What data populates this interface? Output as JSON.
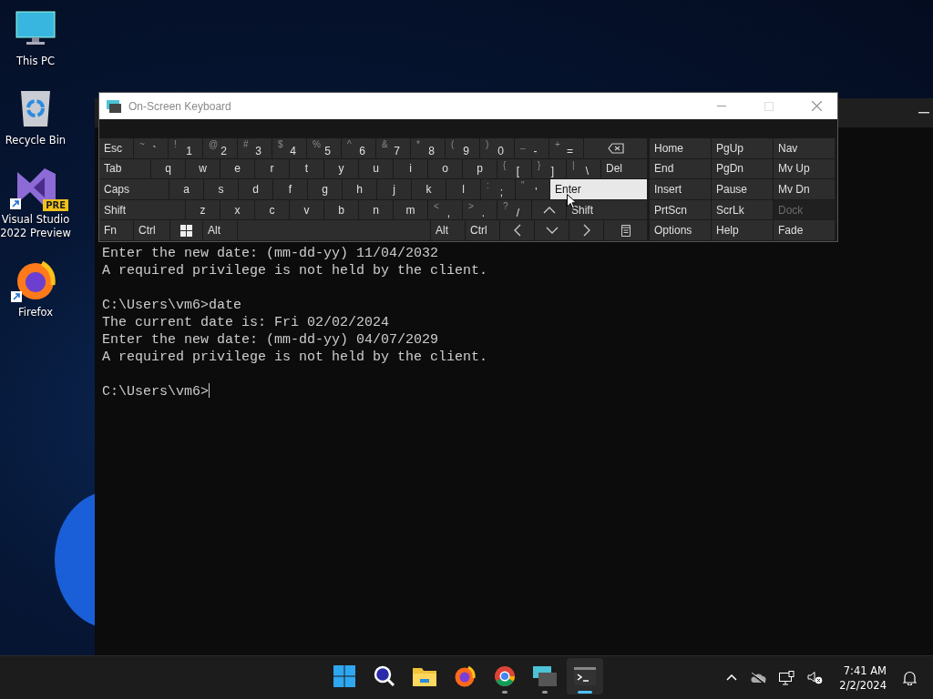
{
  "desktop_icons": [
    {
      "label": "This PC",
      "kind": "pc",
      "shortcut": false
    },
    {
      "label": "Recycle Bin",
      "kind": "bin",
      "shortcut": false
    },
    {
      "label": "Visual Studio 2022 Preview",
      "kind": "vs",
      "shortcut": true,
      "badge": "PRE"
    },
    {
      "label": "Firefox",
      "kind": "firefox",
      "shortcut": true
    }
  ],
  "terminal": {
    "blocks": [
      [
        "Enter the new date: (mm-dd-yy) 11/04/2032",
        "A required privilege is not held by the client."
      ],
      [
        "C:\\Users\\vm6>date",
        "The current date is: Fri 02/02/2024",
        "Enter the new date: (mm-dd-yy) 04/07/2029",
        "A required privilege is not held by the client."
      ]
    ],
    "prompt": "C:\\Users\\vm6>"
  },
  "osk": {
    "title": "On-Screen Keyboard",
    "rows": [
      {
        "keys": [
          {
            "kind": "text",
            "label": "Esc",
            "hover": false,
            "disabled": false
          },
          {
            "kind": "dual",
            "shift": "~",
            "label": "`",
            "hover": false,
            "disabled": false
          },
          {
            "kind": "dual",
            "shift": "!",
            "label": "1",
            "hover": false,
            "disabled": false
          },
          {
            "kind": "dual",
            "shift": "@",
            "label": "2",
            "hover": false,
            "disabled": false
          },
          {
            "kind": "dual",
            "shift": "#",
            "label": "3",
            "hover": false,
            "disabled": false
          },
          {
            "kind": "dual",
            "shift": "$",
            "label": "4",
            "hover": false,
            "disabled": false
          },
          {
            "kind": "dual",
            "shift": "%",
            "label": "5",
            "hover": false,
            "disabled": false
          },
          {
            "kind": "dual",
            "shift": "^",
            "label": "6",
            "hover": false,
            "disabled": false
          },
          {
            "kind": "dual",
            "shift": "&",
            "label": "7",
            "hover": false,
            "disabled": false
          },
          {
            "kind": "dual",
            "shift": "*",
            "label": "8",
            "hover": false,
            "disabled": false
          },
          {
            "kind": "dual",
            "shift": "(",
            "label": "9",
            "hover": false,
            "disabled": false
          },
          {
            "kind": "dual",
            "shift": ")",
            "label": "0",
            "hover": false,
            "disabled": false
          },
          {
            "kind": "dual",
            "shift": "_",
            "label": "-",
            "hover": false,
            "disabled": false
          },
          {
            "kind": "dual",
            "shift": "+",
            "label": "=",
            "hover": false,
            "disabled": false
          },
          {
            "kind": "backspace",
            "hover": false,
            "disabled": false
          }
        ]
      },
      {
        "keys": [
          {
            "kind": "text",
            "label": "Tab",
            "hover": false,
            "disabled": false
          },
          {
            "kind": "letter",
            "label": "q",
            "hover": false,
            "disabled": false
          },
          {
            "kind": "letter",
            "label": "w",
            "hover": false,
            "disabled": false
          },
          {
            "kind": "letter",
            "label": "e",
            "hover": false,
            "disabled": false
          },
          {
            "kind": "letter",
            "label": "r",
            "hover": false,
            "disabled": false
          },
          {
            "kind": "letter",
            "label": "t",
            "hover": false,
            "disabled": false
          },
          {
            "kind": "letter",
            "label": "y",
            "hover": false,
            "disabled": false
          },
          {
            "kind": "letter",
            "label": "u",
            "hover": false,
            "disabled": false
          },
          {
            "kind": "letter",
            "label": "i",
            "hover": false,
            "disabled": false
          },
          {
            "kind": "letter",
            "label": "o",
            "hover": false,
            "disabled": false
          },
          {
            "kind": "letter",
            "label": "p",
            "hover": false,
            "disabled": false
          },
          {
            "kind": "dual",
            "shift": "{",
            "label": "[",
            "hover": false,
            "disabled": false
          },
          {
            "kind": "dual",
            "shift": "}",
            "label": "]",
            "hover": false,
            "disabled": false
          },
          {
            "kind": "dual",
            "shift": "|",
            "label": "\\",
            "hover": false,
            "disabled": false
          },
          {
            "kind": "text",
            "label": "Del",
            "hover": false,
            "disabled": false
          }
        ]
      },
      {
        "keys": [
          {
            "kind": "text",
            "label": "Caps",
            "hover": false,
            "disabled": false
          },
          {
            "kind": "letter",
            "label": "a",
            "hover": false,
            "disabled": false
          },
          {
            "kind": "letter",
            "label": "s",
            "hover": false,
            "disabled": false
          },
          {
            "kind": "letter",
            "label": "d",
            "hover": false,
            "disabled": false
          },
          {
            "kind": "letter",
            "label": "f",
            "hover": false,
            "disabled": false
          },
          {
            "kind": "letter",
            "label": "g",
            "hover": false,
            "disabled": false
          },
          {
            "kind": "letter",
            "label": "h",
            "hover": false,
            "disabled": false
          },
          {
            "kind": "letter",
            "label": "j",
            "hover": false,
            "disabled": false
          },
          {
            "kind": "letter",
            "label": "k",
            "hover": false,
            "disabled": false
          },
          {
            "kind": "letter",
            "label": "l",
            "hover": false,
            "disabled": false
          },
          {
            "kind": "dual",
            "shift": ":",
            "label": ";",
            "hover": false,
            "disabled": false
          },
          {
            "kind": "dual",
            "shift": "\"",
            "label": "'",
            "hover": false,
            "disabled": false
          },
          {
            "kind": "text",
            "label": "Enter",
            "hover": true,
            "disabled": false
          }
        ]
      },
      {
        "keys": [
          {
            "kind": "text",
            "label": "Shift",
            "hover": false,
            "disabled": false
          },
          {
            "kind": "letter",
            "label": "z",
            "hover": false,
            "disabled": false
          },
          {
            "kind": "letter",
            "label": "x",
            "hover": false,
            "disabled": false
          },
          {
            "kind": "letter",
            "label": "c",
            "hover": false,
            "disabled": false
          },
          {
            "kind": "letter",
            "label": "v",
            "hover": false,
            "disabled": false
          },
          {
            "kind": "letter",
            "label": "b",
            "hover": false,
            "disabled": false
          },
          {
            "kind": "letter",
            "label": "n",
            "hover": false,
            "disabled": false
          },
          {
            "kind": "letter",
            "label": "m",
            "hover": false,
            "disabled": false
          },
          {
            "kind": "dual",
            "shift": "<",
            "label": ",",
            "hover": false,
            "disabled": false
          },
          {
            "kind": "dual",
            "shift": ">",
            "label": ".",
            "hover": false,
            "disabled": false
          },
          {
            "kind": "dual",
            "shift": "?",
            "label": "/",
            "hover": false,
            "disabled": false
          },
          {
            "kind": "up",
            "hover": false,
            "disabled": false
          },
          {
            "kind": "text",
            "label": "Shift",
            "hover": false,
            "disabled": false
          }
        ]
      },
      {
        "keys": [
          {
            "kind": "text",
            "label": "Fn",
            "hover": false,
            "disabled": false
          },
          {
            "kind": "text",
            "label": "Ctrl",
            "hover": false,
            "disabled": false
          },
          {
            "kind": "windows",
            "hover": false,
            "disabled": false
          },
          {
            "kind": "text",
            "label": "Alt",
            "hover": false,
            "disabled": false
          },
          {
            "kind": "space",
            "hover": false,
            "disabled": false
          },
          {
            "kind": "text",
            "label": "Alt",
            "hover": false,
            "disabled": false
          },
          {
            "kind": "text",
            "label": "Ctrl",
            "hover": false,
            "disabled": false
          },
          {
            "kind": "left",
            "hover": false,
            "disabled": false
          },
          {
            "kind": "down",
            "hover": false,
            "disabled": false
          },
          {
            "kind": "right",
            "hover": false,
            "disabled": false
          },
          {
            "kind": "menu",
            "hover": false,
            "disabled": false
          }
        ]
      }
    ],
    "side_rows": [
      {
        "keys": [
          {
            "kind": "text",
            "label": "Home",
            "hover": false,
            "disabled": false
          },
          {
            "kind": "text",
            "label": "PgUp",
            "hover": false,
            "disabled": false
          },
          {
            "kind": "text",
            "label": "Nav",
            "hover": false,
            "disabled": false
          }
        ]
      },
      {
        "keys": [
          {
            "kind": "text",
            "label": "End",
            "hover": false,
            "disabled": false
          },
          {
            "kind": "text",
            "label": "PgDn",
            "hover": false,
            "disabled": false
          },
          {
            "kind": "text",
            "label": "Mv Up",
            "hover": false,
            "disabled": false
          }
        ]
      },
      {
        "keys": [
          {
            "kind": "text",
            "label": "Insert",
            "hover": false,
            "disabled": false
          },
          {
            "kind": "text",
            "label": "Pause",
            "hover": false,
            "disabled": false
          },
          {
            "kind": "text",
            "label": "Mv Dn",
            "hover": false,
            "disabled": false
          }
        ]
      },
      {
        "keys": [
          {
            "kind": "text",
            "label": "PrtScn",
            "hover": false,
            "disabled": false
          },
          {
            "kind": "text",
            "label": "ScrLk",
            "hover": false,
            "disabled": false
          },
          {
            "kind": "text",
            "label": "Dock",
            "hover": false,
            "disabled": true
          }
        ]
      },
      {
        "keys": [
          {
            "kind": "text",
            "label": "Options",
            "hover": false,
            "disabled": false
          },
          {
            "kind": "text",
            "label": "Help",
            "hover": false,
            "disabled": false
          },
          {
            "kind": "text",
            "label": "Fade",
            "hover": false,
            "disabled": false
          }
        ]
      }
    ]
  },
  "taskbar": {
    "apps": [
      {
        "kind": "start",
        "running": false,
        "active": false
      },
      {
        "kind": "search",
        "running": false,
        "active": false
      },
      {
        "kind": "folder",
        "running": false,
        "active": false
      },
      {
        "kind": "firefox",
        "running": false,
        "active": false
      },
      {
        "kind": "chrome",
        "running": true,
        "active": false
      },
      {
        "kind": "keyboard",
        "running": true,
        "active": false
      },
      {
        "kind": "terminal",
        "running": true,
        "active": true
      }
    ],
    "tray": [
      {
        "kind": "chevron"
      },
      {
        "kind": "cloud-off"
      },
      {
        "kind": "network"
      },
      {
        "kind": "speaker-muted"
      }
    ],
    "time": "7:41 AM",
    "date": "2/2/2024"
  }
}
